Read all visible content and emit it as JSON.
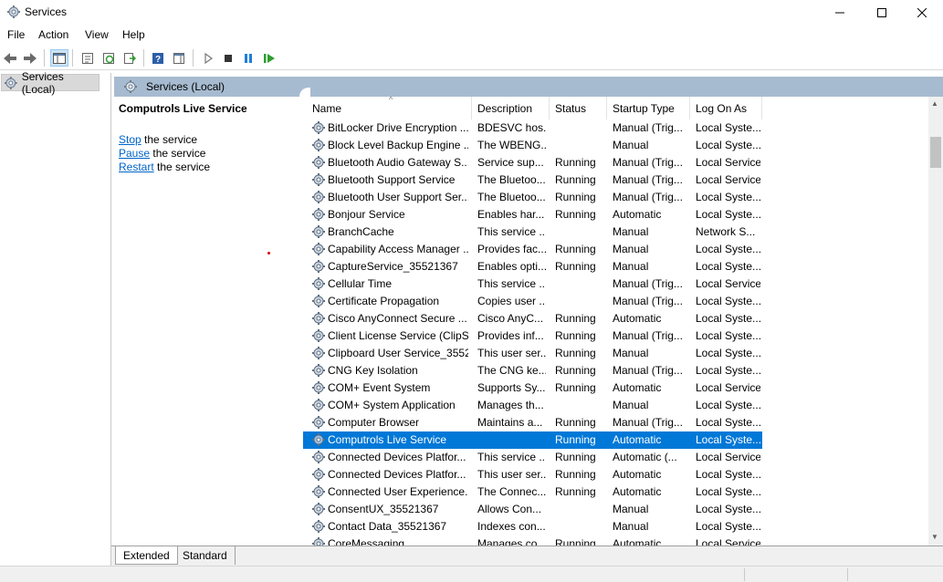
{
  "window": {
    "title": "Services",
    "app_icon": "services-gear-icon"
  },
  "menu": [
    "File",
    "Action",
    "View",
    "Help"
  ],
  "toolbar": {
    "buttons": [
      {
        "name": "back-icon"
      },
      {
        "name": "forward-icon"
      },
      {
        "name": "show-hide-console-tree-icon"
      },
      {
        "name": "properties-icon"
      },
      {
        "name": "refresh-icon"
      },
      {
        "name": "export-list-icon"
      },
      {
        "name": "help-icon"
      },
      {
        "name": "action-pane-icon"
      },
      {
        "name": "start-service-icon"
      },
      {
        "name": "stop-service-icon"
      },
      {
        "name": "pause-service-icon"
      },
      {
        "name": "resume-service-icon"
      }
    ]
  },
  "tree": {
    "root_label": "Services (Local)"
  },
  "header": {
    "label": "Services (Local)"
  },
  "extended": {
    "title": "Computrols Live Service",
    "actions": [
      {
        "link": "Stop",
        "rest": " the service"
      },
      {
        "link": "Pause",
        "rest": " the service"
      },
      {
        "link": "Restart",
        "rest": " the service"
      }
    ]
  },
  "columns": [
    "Name",
    "Description",
    "Status",
    "Startup Type",
    "Log On As"
  ],
  "rows": [
    {
      "name": "BitLocker Drive Encryption ...",
      "desc": "BDESVC hos...",
      "status": "",
      "startup": "Manual (Trig...",
      "logon": "Local Syste..."
    },
    {
      "name": "Block Level Backup Engine ...",
      "desc": "The WBENG...",
      "status": "",
      "startup": "Manual",
      "logon": "Local Syste..."
    },
    {
      "name": "Bluetooth Audio Gateway S...",
      "desc": "Service sup...",
      "status": "Running",
      "startup": "Manual (Trig...",
      "logon": "Local Service"
    },
    {
      "name": "Bluetooth Support Service",
      "desc": "The Bluetoo...",
      "status": "Running",
      "startup": "Manual (Trig...",
      "logon": "Local Service"
    },
    {
      "name": "Bluetooth User Support Ser...",
      "desc": "The Bluetoo...",
      "status": "Running",
      "startup": "Manual (Trig...",
      "logon": "Local Syste..."
    },
    {
      "name": "Bonjour Service",
      "desc": "Enables har...",
      "status": "Running",
      "startup": "Automatic",
      "logon": "Local Syste..."
    },
    {
      "name": "BranchCache",
      "desc": "This service ...",
      "status": "",
      "startup": "Manual",
      "logon": "Network S..."
    },
    {
      "name": "Capability Access Manager ...",
      "desc": "Provides fac...",
      "status": "Running",
      "startup": "Manual",
      "logon": "Local Syste..."
    },
    {
      "name": "CaptureService_35521367",
      "desc": "Enables opti...",
      "status": "Running",
      "startup": "Manual",
      "logon": "Local Syste..."
    },
    {
      "name": "Cellular Time",
      "desc": "This service ...",
      "status": "",
      "startup": "Manual (Trig...",
      "logon": "Local Service"
    },
    {
      "name": "Certificate Propagation",
      "desc": "Copies user ...",
      "status": "",
      "startup": "Manual (Trig...",
      "logon": "Local Syste..."
    },
    {
      "name": "Cisco AnyConnect Secure ...",
      "desc": "Cisco AnyC...",
      "status": "Running",
      "startup": "Automatic",
      "logon": "Local Syste..."
    },
    {
      "name": "Client License Service (ClipS...",
      "desc": "Provides inf...",
      "status": "Running",
      "startup": "Manual (Trig...",
      "logon": "Local Syste..."
    },
    {
      "name": "Clipboard User Service_3552...",
      "desc": "This user ser...",
      "status": "Running",
      "startup": "Manual",
      "logon": "Local Syste..."
    },
    {
      "name": "CNG Key Isolation",
      "desc": "The CNG ke...",
      "status": "Running",
      "startup": "Manual (Trig...",
      "logon": "Local Syste..."
    },
    {
      "name": "COM+ Event System",
      "desc": "Supports Sy...",
      "status": "Running",
      "startup": "Automatic",
      "logon": "Local Service"
    },
    {
      "name": "COM+ System Application",
      "desc": "Manages th...",
      "status": "",
      "startup": "Manual",
      "logon": "Local Syste..."
    },
    {
      "name": "Computer Browser",
      "desc": "Maintains a...",
      "status": "Running",
      "startup": "Manual (Trig...",
      "logon": "Local Syste..."
    },
    {
      "name": "Computrols Live Service",
      "desc": "",
      "status": "Running",
      "startup": "Automatic",
      "logon": "Local Syste...",
      "selected": true
    },
    {
      "name": "Connected Devices Platfor...",
      "desc": "This service ...",
      "status": "Running",
      "startup": "Automatic (...",
      "logon": "Local Service"
    },
    {
      "name": "Connected Devices Platfor...",
      "desc": "This user ser...",
      "status": "Running",
      "startup": "Automatic",
      "logon": "Local Syste..."
    },
    {
      "name": "Connected User Experience...",
      "desc": "The Connec...",
      "status": "Running",
      "startup": "Automatic",
      "logon": "Local Syste..."
    },
    {
      "name": "ConsentUX_35521367",
      "desc": "Allows Con...",
      "status": "",
      "startup": "Manual",
      "logon": "Local Syste..."
    },
    {
      "name": "Contact Data_35521367",
      "desc": "Indexes con...",
      "status": "",
      "startup": "Manual",
      "logon": "Local Syste..."
    },
    {
      "name": "CoreMessaging",
      "desc": "Manages co...",
      "status": "Running",
      "startup": "Automatic",
      "logon": "Local Service"
    }
  ],
  "tabs": [
    "Extended",
    "Standard"
  ],
  "colors": {
    "selection": "#0078d7",
    "header_band": "#a7bbd0",
    "link": "#0064c8"
  }
}
